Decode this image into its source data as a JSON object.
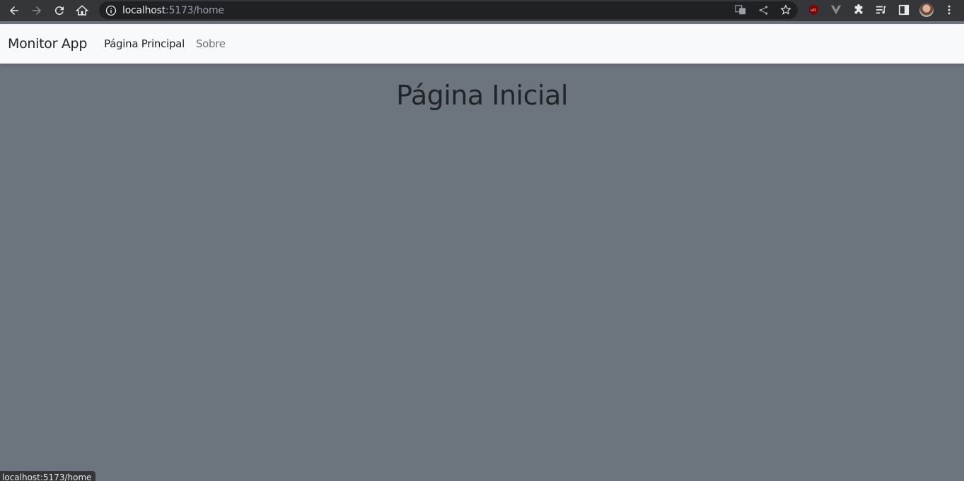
{
  "browser": {
    "url_host": "localhost",
    "url_path": ":5173/home",
    "status_url": "localhost:5173/home"
  },
  "navbar": {
    "brand": "Monitor App",
    "links": [
      {
        "label": "Página Principal",
        "active": true
      },
      {
        "label": "Sobre",
        "active": false
      }
    ]
  },
  "main": {
    "title": "Página Inicial"
  },
  "colors": {
    "page_background": "#6c757d",
    "navbar_background": "#f8f9fa",
    "text_dark": "#212529",
    "text_muted": "#6c757d",
    "chrome_background": "#35363a"
  },
  "icons": [
    "back-arrow-icon",
    "forward-arrow-icon",
    "reload-icon",
    "home-icon",
    "info-icon",
    "translate-icon",
    "share-icon",
    "bookmark-star-icon",
    "ublock-icon",
    "vue-devtools-icon",
    "extensions-puzzle-icon",
    "reading-list-icon",
    "side-panel-icon",
    "profile-avatar",
    "menu-kebab-icon"
  ]
}
